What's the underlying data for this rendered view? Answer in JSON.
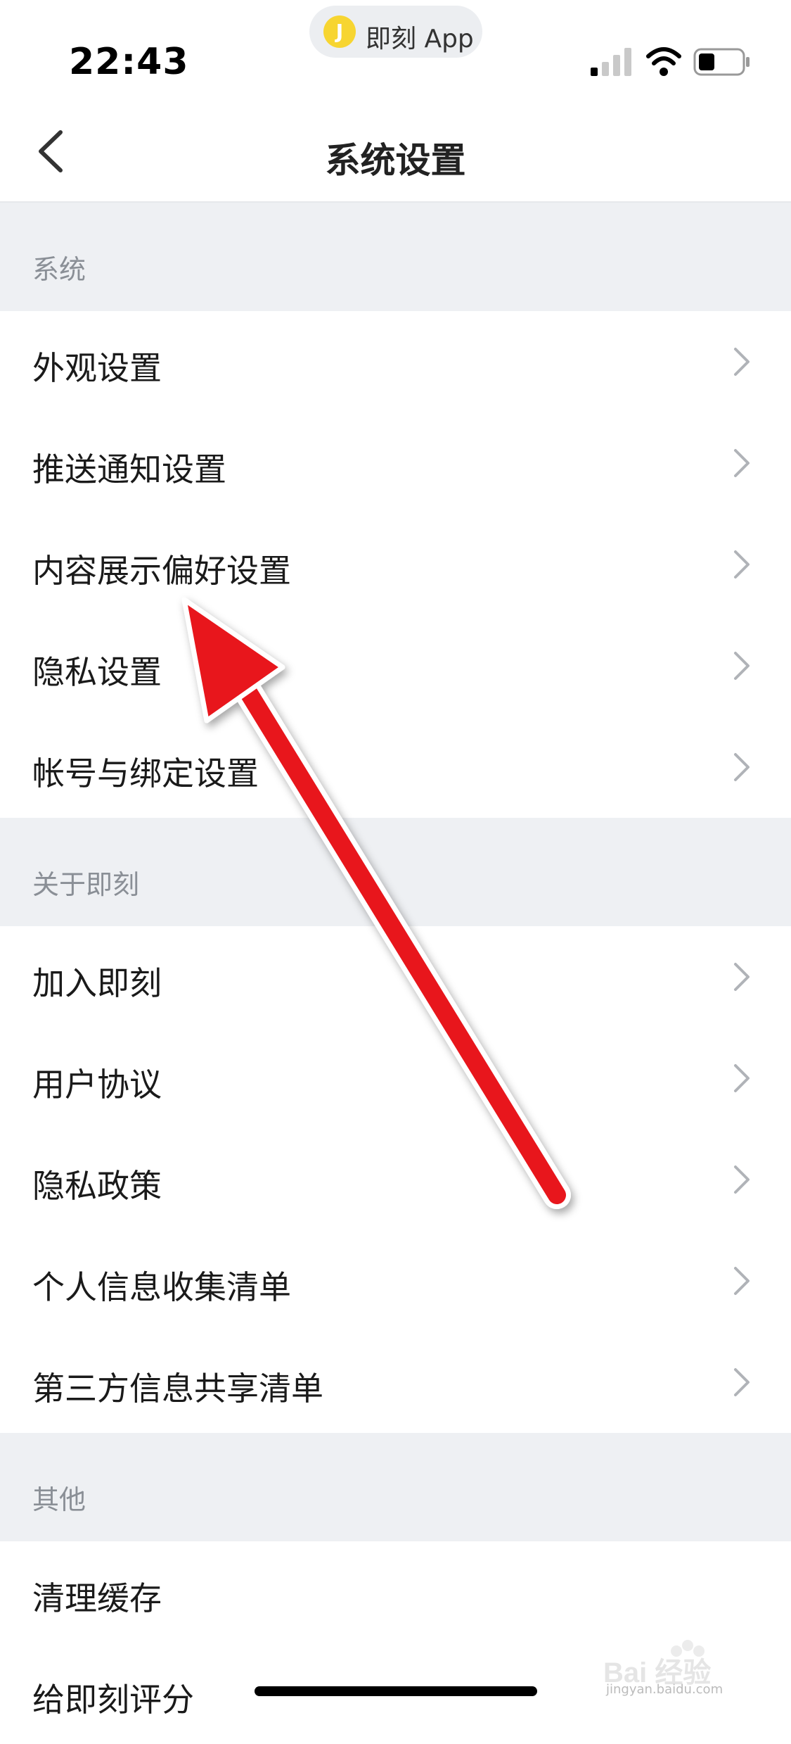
{
  "status_bar": {
    "time": "22:43",
    "app_pill_label": "即刻 App",
    "app_logo_letter": "J"
  },
  "nav": {
    "title": "系统设置"
  },
  "sections": [
    {
      "header": "系统",
      "items": [
        "外观设置",
        "推送通知设置",
        "内容展示偏好设置",
        "隐私设置",
        "帐号与绑定设置"
      ]
    },
    {
      "header": "关于即刻",
      "items": [
        "加入即刻",
        "用户协议",
        "隐私政策",
        "个人信息收集清单",
        "第三方信息共享清单"
      ]
    },
    {
      "header": "其他",
      "items": [
        "清理缓存",
        "给即刻评分"
      ]
    }
  ],
  "watermark": {
    "brand": "Bai 经验",
    "url": "jingyan.baidu.com"
  },
  "colors": {
    "accent_logo": "#f7d531",
    "section_bg": "#eef0f3",
    "annotation_arrow": "#e8141e"
  }
}
